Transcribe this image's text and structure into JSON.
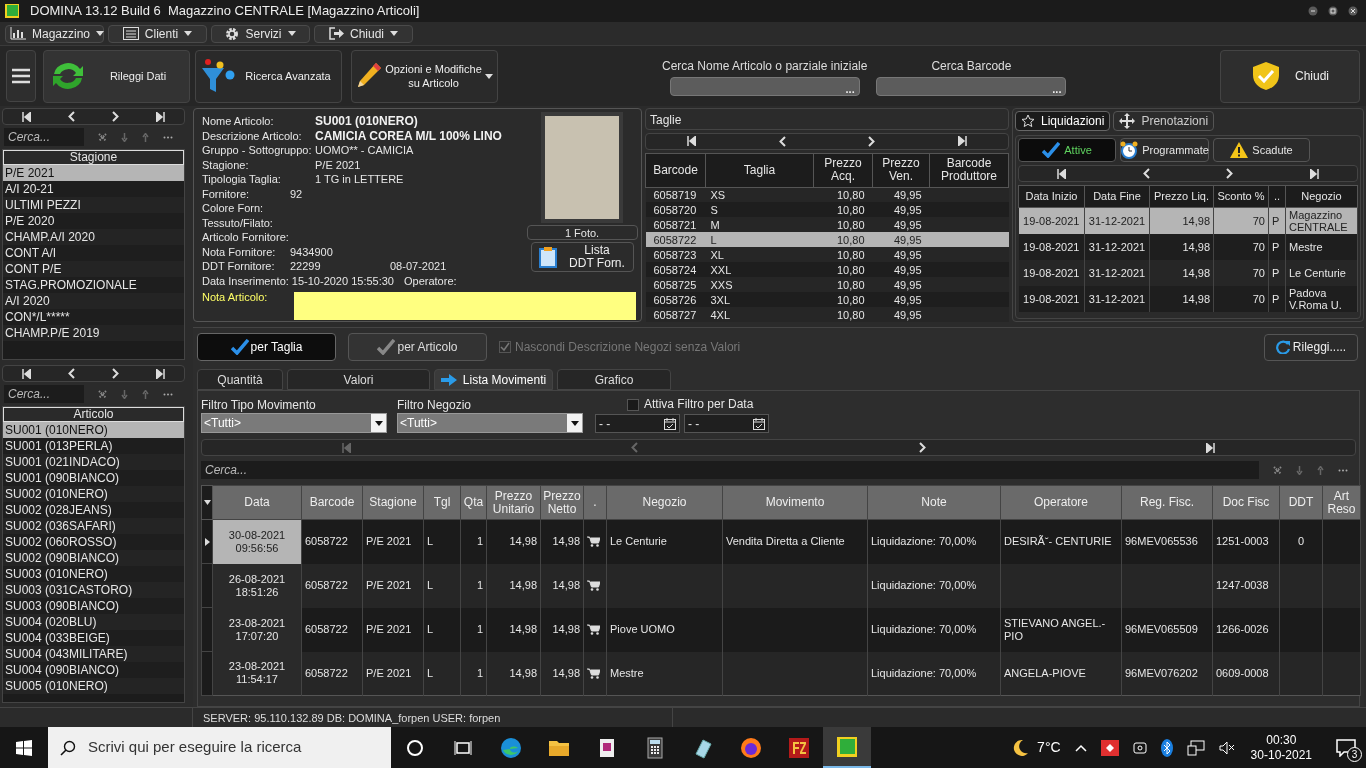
{
  "window": {
    "title": "DOMINA 13.12 Build 6  Magazzino CENTRALE [Magazzino Articoli]"
  },
  "menu": [
    {
      "label": "Magazzino",
      "kind": "chart"
    },
    {
      "label": "Clienti",
      "kind": "list"
    },
    {
      "label": "Servizi",
      "kind": "gear"
    },
    {
      "label": "Chiudi",
      "kind": "exit"
    }
  ],
  "toolbar": {
    "buttons": [
      {
        "label": "Rileggi Dati",
        "kind": "refresh"
      },
      {
        "label": "Ricerca Avanzata",
        "kind": "filter"
      },
      {
        "label": "Opzioni e Modifiche su Articolo",
        "kind": "pencil"
      }
    ],
    "search_name": {
      "label": "Cerca Nome Articolo o parziale iniziale",
      "button": "..."
    },
    "search_barcode": {
      "label": "Cerca Barcode",
      "button": "..."
    },
    "close_button": {
      "label": "Chiudi"
    }
  },
  "stagioni": {
    "search_placeholder": "Cerca...",
    "header": "Stagione",
    "items": [
      {
        "label": "P/E 2021",
        "selected": true
      },
      {
        "label": "A/I 20-21",
        "selected": false
      },
      {
        "label": "ULTIMI PEZZI",
        "selected": false
      },
      {
        "label": "P/E 2020",
        "selected": false
      },
      {
        "label": "CHAMP.A/I 2020",
        "selected": false
      },
      {
        "label": "CONT A/I",
        "selected": false
      },
      {
        "label": "CONT P/E",
        "selected": false
      },
      {
        "label": "STAG.PROMOZIONALE",
        "selected": false
      },
      {
        "label": "A/I 2020",
        "selected": false
      },
      {
        "label": "CON*/L*****",
        "selected": false
      },
      {
        "label": "CHAMP.P/E 2019",
        "selected": false
      }
    ]
  },
  "articoli": {
    "search_placeholder": "Cerca...",
    "header": "Articolo",
    "items": [
      {
        "label": "SU001 (010NERO)",
        "selected": true
      },
      {
        "label": "SU001 (013PERLA)",
        "selected": false
      },
      {
        "label": "SU001 (021INDACO)",
        "selected": false
      },
      {
        "label": "SU001 (090BIANCO)",
        "selected": false
      },
      {
        "label": "SU002 (010NERO)",
        "selected": false
      },
      {
        "label": "SU002 (028JEANS)",
        "selected": false
      },
      {
        "label": "SU002 (036SAFARI)",
        "selected": false
      },
      {
        "label": "SU002 (060ROSSO)",
        "selected": false
      },
      {
        "label": "SU002 (090BIANCO)",
        "selected": false
      },
      {
        "label": "SU003 (010NERO)",
        "selected": false
      },
      {
        "label": "SU003 (031CASTORO)",
        "selected": false
      },
      {
        "label": "SU003 (090BIANCO)",
        "selected": false
      },
      {
        "label": "SU004 (020BLU)",
        "selected": false
      },
      {
        "label": "SU004 (033BEIGE)",
        "selected": false
      },
      {
        "label": "SU004 (043MILITARE)",
        "selected": false
      },
      {
        "label": "SU004 (090BIANCO)",
        "selected": false
      },
      {
        "label": "SU005 (010NERO)",
        "selected": false
      }
    ]
  },
  "article": {
    "fields": [
      {
        "label": "Nome Articolo:",
        "kind": "bold",
        "values": [
          "SU001 (010NERO)"
        ]
      },
      {
        "label": "Descrizione Articolo:",
        "kind": "bold",
        "values": [
          "CAMICIA COREA M/L 100% LINO"
        ]
      },
      {
        "label": "Gruppo - Sottogruppo:",
        "kind": "plain",
        "values": [
          "UOMO** - CAMICIA"
        ]
      },
      {
        "label": "Stagione:",
        "kind": "plain",
        "values": [
          "P/E 2021"
        ]
      },
      {
        "label": "Tipologia Taglia:",
        "kind": "plain",
        "values": [
          "1 TG in LETTERE"
        ]
      },
      {
        "label": "Fornitore:",
        "kind": "short",
        "values": [
          "92"
        ]
      },
      {
        "label": "Colore Forn:",
        "kind": "plain"
      },
      {
        "label": "Tessuto/Filato:",
        "kind": "plain"
      },
      {
        "label": "Articolo Fornitore:",
        "kind": "plain"
      },
      {
        "label": "Nota Fornitore:",
        "kind": "short",
        "values": [
          "9434900"
        ]
      },
      {
        "label": "DDT Fornitore:",
        "kind": "short",
        "values": [
          "22299",
          "08-07-2021"
        ]
      },
      {
        "label": "Data Inserimento:",
        "kind": "date",
        "values": [
          "15-10-2020 15:55:30",
          "Operatore:"
        ]
      }
    ],
    "note_label": "Nota Articolo:",
    "photo_caption": "1 Foto.",
    "ddt_button": "Lista\nDDT Forn."
  },
  "taglie": {
    "title": "Taglie",
    "columns": [
      "Barcode",
      "Taglia",
      "Prezzo Acq.",
      "Prezzo Ven.",
      "Barcode Produttore"
    ],
    "rows": [
      {
        "cells": [
          "6058719",
          "XS",
          "10,80",
          "49,95"
        ],
        "selected": false
      },
      {
        "cells": [
          "6058720",
          "S",
          "10,80",
          "49,95"
        ],
        "selected": false
      },
      {
        "cells": [
          "6058721",
          "M",
          "10,80",
          "49,95"
        ],
        "selected": false
      },
      {
        "cells": [
          "6058722",
          "L",
          "10,80",
          "49,95"
        ],
        "selected": true
      },
      {
        "cells": [
          "6058723",
          "XL",
          "10,80",
          "49,95"
        ],
        "selected": false
      },
      {
        "cells": [
          "6058724",
          "XXL",
          "10,80",
          "49,95"
        ],
        "selected": false
      },
      {
        "cells": [
          "6058725",
          "XXS",
          "10,80",
          "49,95"
        ],
        "selected": false
      },
      {
        "cells": [
          "6058726",
          "3XL",
          "10,80",
          "49,95"
        ],
        "selected": false
      },
      {
        "cells": [
          "6058727",
          "4XL",
          "10,80",
          "49,95"
        ],
        "selected": false
      }
    ]
  },
  "liquidazioni": {
    "tabs": [
      {
        "label": "Liquidazioni",
        "kind": "star",
        "selected": true
      },
      {
        "label": "Prenotazioni",
        "kind": "move",
        "selected": false
      }
    ],
    "filters": [
      {
        "label": "Attive",
        "kind": "check",
        "selected": true
      },
      {
        "label": "Programmate",
        "kind": "alarm",
        "selected": false
      },
      {
        "label": "Scadute",
        "kind": "warning",
        "selected": false
      }
    ],
    "columns": [
      "Data Inizio",
      "Data Fine",
      "Prezzo Liq.",
      "Sconto %",
      "..",
      "Negozio"
    ],
    "rows": [
      {
        "cells": [
          "19-08-2021",
          "31-12-2021",
          "14,98",
          "70",
          "P",
          "Magazzino CENTRALE"
        ],
        "selected": true
      },
      {
        "cells": [
          "19-08-2021",
          "31-12-2021",
          "14,98",
          "70",
          "P",
          "Mestre"
        ],
        "selected": false
      },
      {
        "cells": [
          "19-08-2021",
          "31-12-2021",
          "14,98",
          "70",
          "P",
          "Le Centurie"
        ],
        "selected": false
      },
      {
        "cells": [
          "19-08-2021",
          "31-12-2021",
          "14,98",
          "70",
          "P",
          "Padova V.Roma U."
        ],
        "selected": false
      }
    ]
  },
  "movimenti": {
    "views": [
      {
        "label": "per Taglia",
        "selected": true
      },
      {
        "label": "per Articolo",
        "selected": false
      }
    ],
    "hide_option": {
      "label": "Nascondi Descrizione Negozi senza Valori",
      "checked": true,
      "disabled": true
    },
    "reload_button": "Rileggi.....",
    "tabs": [
      {
        "label": "Quantità",
        "selected": false
      },
      {
        "label": "Valori",
        "selected": false
      },
      {
        "label": "Lista Movimenti",
        "selected": true
      },
      {
        "label": "Grafico",
        "selected": false
      }
    ],
    "filter_type": {
      "label": "Filtro Tipo Movimento",
      "value": "<Tutti>"
    },
    "filter_shop": {
      "label": "Filtro Negozio",
      "value": "<Tutti>"
    },
    "date_filter": {
      "label": "Attiva Filtro per Data",
      "checked": false,
      "from": "- -",
      "to": "- -"
    },
    "search_placeholder": "Cerca...",
    "columns": [
      {
        "label": "Data",
        "kind": "text"
      },
      {
        "label": "Barcode",
        "kind": "text"
      },
      {
        "label": "Stagione",
        "kind": "text"
      },
      {
        "label": "Tgl",
        "kind": "text"
      },
      {
        "label": "Qta",
        "kind": "text"
      },
      {
        "label": "Prezzo Unitario",
        "kind": "text"
      },
      {
        "label": "Prezzo Netto",
        "kind": "text"
      },
      {
        "label": ".",
        "kind": "icon"
      },
      {
        "label": "Negozio",
        "kind": "text"
      },
      {
        "label": "Movimento",
        "kind": "text"
      },
      {
        "label": "Note",
        "kind": "text"
      },
      {
        "label": "Operatore",
        "kind": "text"
      },
      {
        "label": "Reg. Fisc.",
        "kind": "text"
      },
      {
        "label": "Doc Fisc",
        "kind": "text"
      },
      {
        "label": "DDT",
        "kind": "text"
      },
      {
        "label": "Art Reso",
        "kind": "text"
      }
    ],
    "rows": [
      {
        "selected": true,
        "cells": [
          "30-08-2021 09:56:56",
          "6058722",
          "P/E 2021",
          "L",
          "1",
          "14,98",
          "14,98",
          "",
          "Le Centurie",
          "Vendita Diretta a Cliente",
          "Liquidazione: 70,00%",
          "DESIRÃ˘- CENTURIE",
          "96MEV065536",
          "1251-0003",
          "0"
        ]
      },
      {
        "selected": false,
        "cells": [
          "26-08-2021 18:51:26",
          "6058722",
          "P/E 2021",
          "L",
          "1",
          "14,98",
          "14,98",
          "",
          "",
          "",
          "Liquidazione: 70,00%",
          "",
          "",
          "1247-0038"
        ]
      },
      {
        "selected": false,
        "cells": [
          "23-08-2021 17:07:20",
          "6058722",
          "P/E 2021",
          "L",
          "1",
          "14,98",
          "14,98",
          "",
          "Piove UOMO",
          "",
          "Liquidazione: 70,00%",
          "STIEVANO ANGEL.-PIO",
          "96MEV065509",
          "1266-0026"
        ]
      },
      {
        "selected": false,
        "cells": [
          "23-08-2021 11:54:17",
          "6058722",
          "P/E 2021",
          "L",
          "1",
          "14,98",
          "14,98",
          "",
          "Mestre",
          "",
          "Liquidazione: 70,00%",
          "ANGELA-PIOVE",
          "96MEV076202",
          "0609-0008"
        ]
      }
    ]
  },
  "status_bar": "SERVER: 95.110.132.89 DB: DOMINA_forpen USER: forpen",
  "taskbar": {
    "search_placeholder": "Scrivi qui per eseguire la ricerca",
    "temperature": "7°C",
    "time": "00:30",
    "date": "30-10-2021",
    "notifications": "3"
  }
}
